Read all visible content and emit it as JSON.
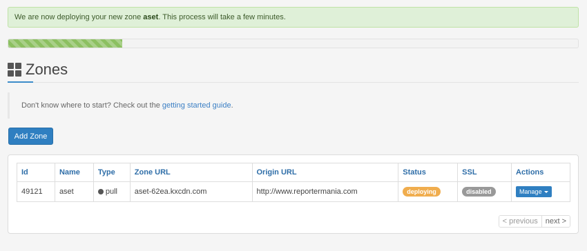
{
  "alert": {
    "prefix": "We are now deploying your new zone ",
    "zone": "aset",
    "suffix": ". This process will take a few minutes."
  },
  "progress": {
    "percent": 20,
    "color": "#8cc061"
  },
  "page": {
    "icon": "grid-icon",
    "title": "Zones"
  },
  "callout": {
    "text": "Don't know where to start? Check out the ",
    "link": "getting started guide",
    "end": "."
  },
  "toolbar": {
    "add_label": "Add Zone"
  },
  "table": {
    "columns": [
      "Id",
      "Name",
      "Type",
      "Zone URL",
      "Origin URL",
      "Status",
      "SSL",
      "Actions"
    ],
    "rows": [
      {
        "id": "49121",
        "name": "aset",
        "type": "pull",
        "zone_url": "aset-62ea.kxcdn.com",
        "origin_url": "http://www.reportermania.com",
        "status": "deploying",
        "ssl": "disabled",
        "action": "Manage"
      }
    ]
  },
  "pager": {
    "prev": "< previous",
    "next": "next >"
  },
  "colors": {
    "accent": "#2f7fc1",
    "status_deploying": "#f0ad4e",
    "ssl_disabled": "#999999"
  }
}
